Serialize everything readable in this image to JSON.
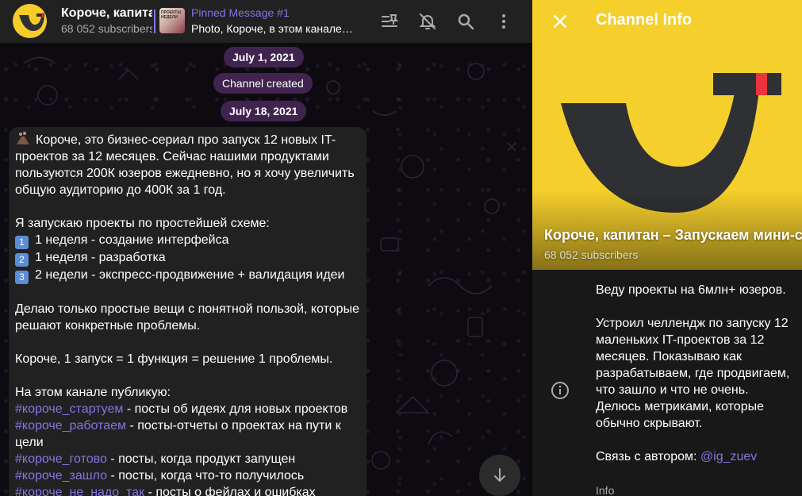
{
  "header": {
    "title": "Короче, капитан – Запускаем мини-стартапы",
    "subscribers": "68 052 subscribers",
    "pinned": {
      "label": "Pinned Message #1",
      "text": "Photo, Короче, в этом канале…",
      "thumb_text": "ПРОЕКТЫ НЕДЕЛИ"
    }
  },
  "dates": {
    "first": "July 1, 2021",
    "created": "Channel created",
    "second": "July 18, 2021"
  },
  "message": {
    "p1": "Короче, это бизнес-сериал про запуск 12 новых IT-проектов за 12 месяцев. Сейчас нашими продуктами пользуются 200К юзеров ежедневно, но я хочу увеличить общую аудиторию до 400К за 1 год.",
    "p2_intro": "Я запускаю проекты по простейшей схеме:",
    "steps": [
      {
        "num": "1",
        "text": "1 неделя - создание интерфейса"
      },
      {
        "num": "2",
        "text": "1 неделя - разработка"
      },
      {
        "num": "3",
        "text": "2 недели - экспресс-продвижение + валидация идеи"
      }
    ],
    "p3": "Делаю только простые вещи с понятной пользой, которые решают конкретные проблемы.",
    "p4": "Короче, 1 запуск = 1 функция = решение 1 проблемы.",
    "p5_intro": "На этом канале публикую:",
    "tags": [
      {
        "tag": "#короче_стартуем",
        "text": " - посты об идеях для новых проектов"
      },
      {
        "tag": "#короче_работаем",
        "text": " - посты-отчеты о проектах на пути к цели"
      },
      {
        "tag": "#короче_готово",
        "text": " - посты, когда продукт запущен"
      },
      {
        "tag": "#короче_зашло",
        "text": " - посты, когда что-то получилось"
      },
      {
        "tag": "#короче_не_надо_так",
        "text": " - посты о фейлах и ошибках"
      }
    ]
  },
  "panel": {
    "title": "Channel Info",
    "cover_title": "Короче, капитан – Запускаем мини-стартапы",
    "cover_subscribers": "68 052 subscribers",
    "description": "Веду проекты на 6млн+ юзеров.\n\nУстроил челлендж по запуску 12 маленьких IT-проектов за 12 месяцев. Показываю как разрабатываем, где продвигаем, что зашло и что не очень. Делюсь метриками, которые обычно скрывают.\n\nСвязь с автором: ",
    "author_handle": "@ig_zuev",
    "info_label": "Info"
  },
  "colors": {
    "accent": "#8774e1",
    "logo_yellow": "#f5cf2b",
    "logo_dark": "#2f3033",
    "logo_red": "#e8343f"
  },
  "icons": [
    "pinned-list-icon",
    "mute-icon",
    "search-icon",
    "more-vertical-icon",
    "close-icon",
    "info-icon",
    "arrow-down-icon"
  ]
}
